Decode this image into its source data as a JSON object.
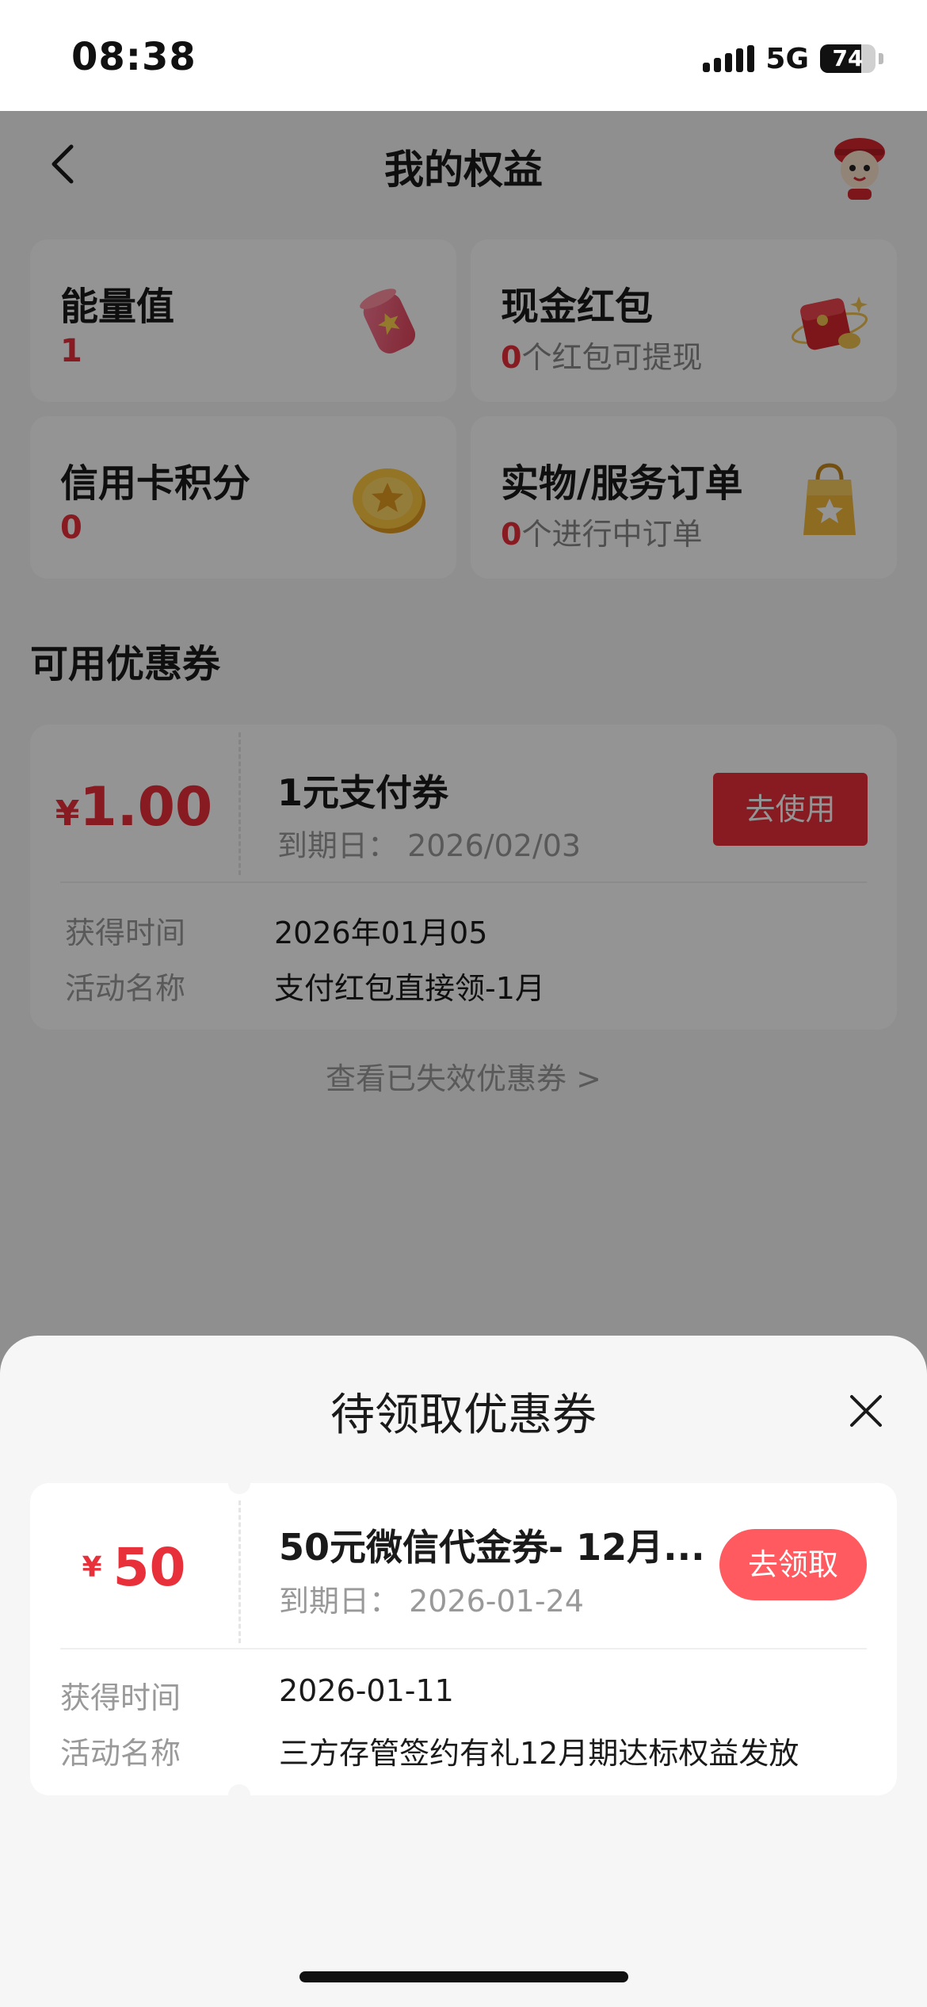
{
  "status_bar": {
    "time": "08:38",
    "network": "5G",
    "battery": "74",
    "battery_level_percent": 74
  },
  "nav": {
    "title": "我的权益",
    "back_icon": "chevron-left-icon",
    "avatar_icon": "mascot-avatar-icon"
  },
  "stats": {
    "energy": {
      "title": "能量值",
      "value": "1",
      "icon": "lucky-bag-icon"
    },
    "cash_redpacket": {
      "title": "现金红包",
      "count": "0",
      "suffix": "个红包可提现",
      "icon": "red-envelope-icon"
    },
    "credit_points": {
      "title": "信用卡积分",
      "value": "0",
      "icon": "gold-coin-icon"
    },
    "orders": {
      "title": "实物/服务订单",
      "count": "0",
      "suffix": "个进行中订单",
      "icon": "shopping-bag-icon"
    }
  },
  "available_coupons": {
    "section_title": "可用优惠券",
    "items": [
      {
        "currency": "¥",
        "amount": "1.00",
        "name": "1元支付券",
        "expiry": "到期日： 2026/02/03",
        "button": "去使用",
        "obtained_label": "获得时间",
        "obtained_value": "2026年01月05",
        "activity_label": "活动名称",
        "activity_value": "支付红包直接领-1月"
      }
    ],
    "expired_link": "查看已失效优惠券 >"
  },
  "pending_sheet": {
    "title": "待领取优惠券",
    "close_icon": "close-icon",
    "items": [
      {
        "currency": "¥",
        "amount": "50",
        "name": "50元微信代金券- 12月...",
        "expiry": "到期日： 2026-01-24",
        "button": "去领取",
        "obtained_label": "获得时间",
        "obtained_value": "2026-01-11",
        "activity_label": "活动名称",
        "activity_value": "三方存管签约有礼12月期达标权益发放"
      }
    ]
  },
  "colors": {
    "accent_red": "#e8303a",
    "use_button": "#e8303a",
    "claim_button": "#ff5a5f",
    "overlay": "rgba(0,0,0,0.42)"
  }
}
